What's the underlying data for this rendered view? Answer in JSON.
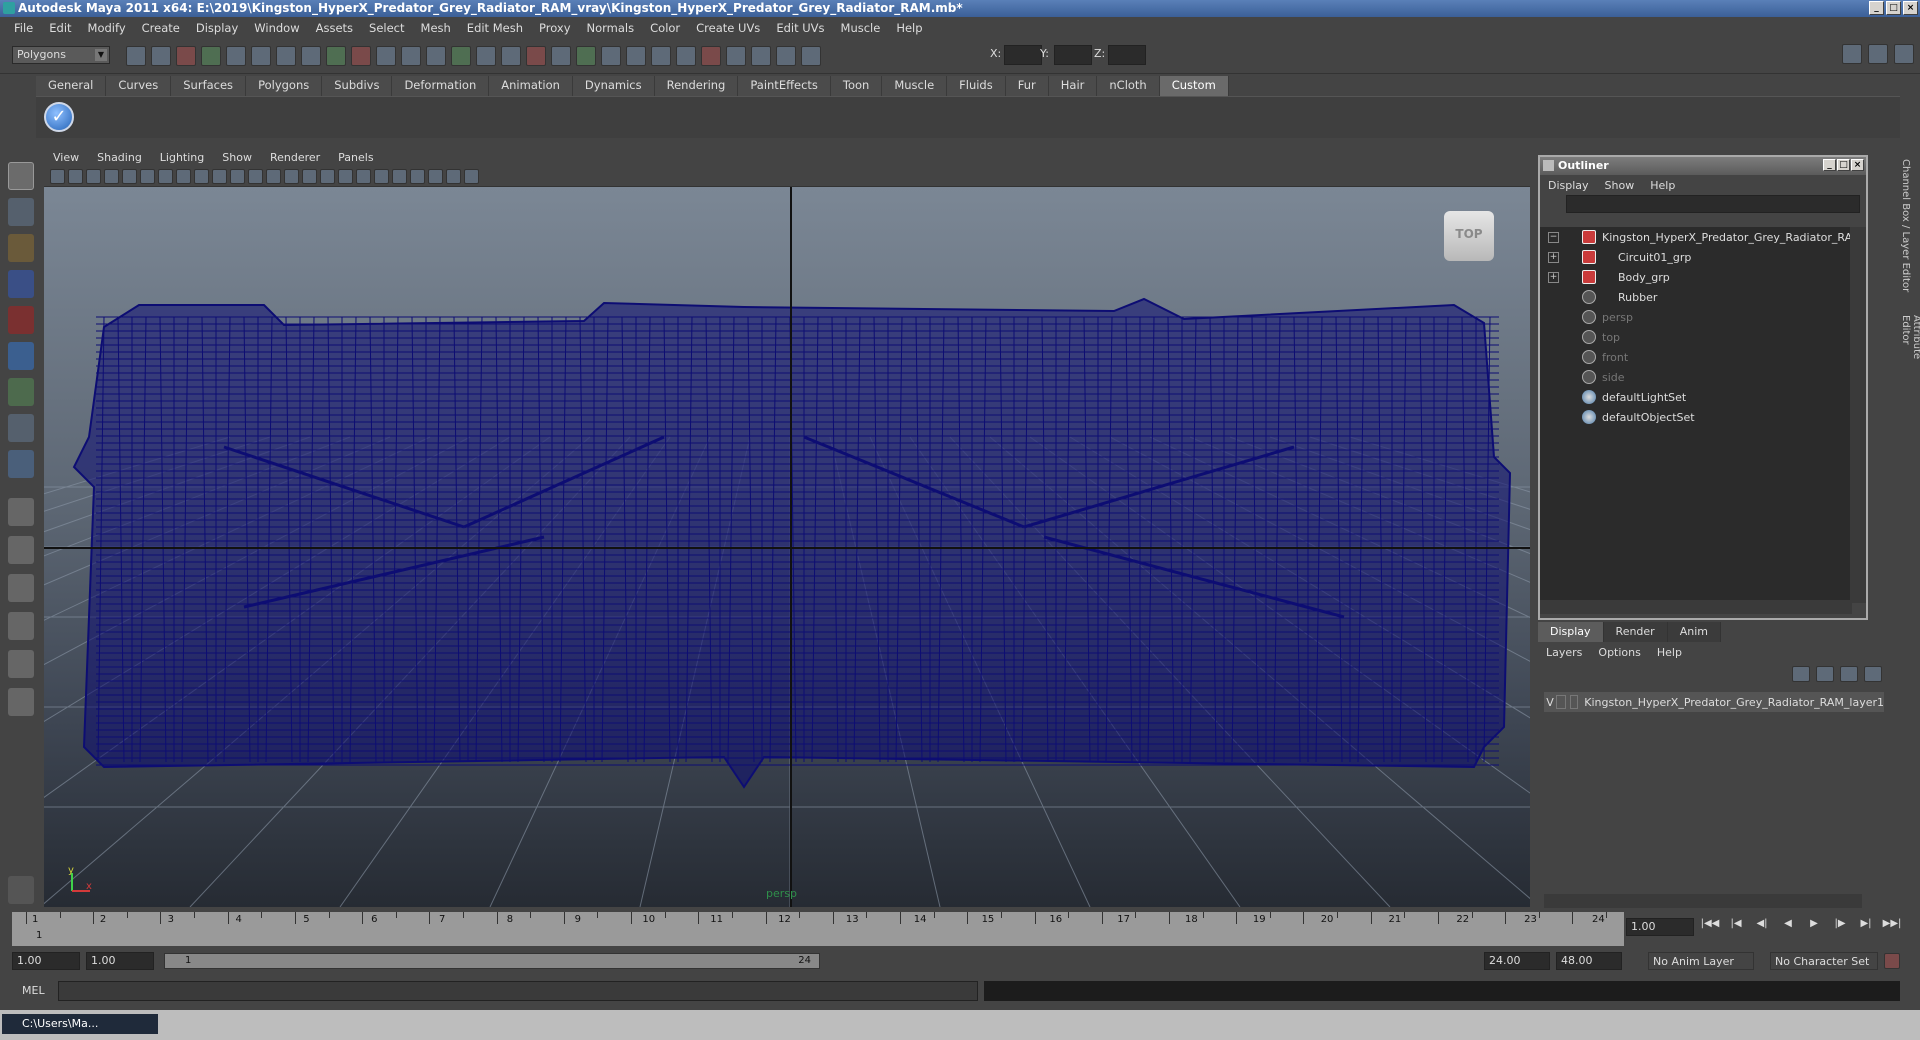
{
  "window": {
    "title": "Autodesk Maya 2011 x64: E:\\2019\\Kingston_HyperX_Predator_Grey_Radiator_RAM_vray\\Kingston_HyperX_Predator_Grey_Radiator_RAM.mb*",
    "min": "_",
    "max": "□",
    "close": "×"
  },
  "menu": [
    "File",
    "Edit",
    "Modify",
    "Create",
    "Display",
    "Window",
    "Assets",
    "Select",
    "Mesh",
    "Edit Mesh",
    "Proxy",
    "Normals",
    "Color",
    "Create UVs",
    "Edit UVs",
    "Muscle",
    "Help"
  ],
  "toolbar": {
    "mode": "Polygons",
    "x_label": "X:",
    "y_label": "Y:",
    "z_label": "Z:"
  },
  "shelf_tabs": [
    "General",
    "Curves",
    "Surfaces",
    "Polygons",
    "Subdivs",
    "Deformation",
    "Animation",
    "Dynamics",
    "Rendering",
    "PaintEffects",
    "Toon",
    "Muscle",
    "Fluids",
    "Fur",
    "Hair",
    "nCloth",
    "Custom"
  ],
  "shelf_active": "Custom",
  "viewport": {
    "menu": [
      "View",
      "Shading",
      "Lighting",
      "Show",
      "Renderer",
      "Panels"
    ],
    "cube_label": "TOP",
    "camera_label": "persp",
    "mesh_color": "#0d0d73"
  },
  "outliner": {
    "title": "Outliner",
    "menu": [
      "Display",
      "Show",
      "Help"
    ],
    "items": [
      {
        "label": "Kingston_HyperX_Predator_Grey_Radiator_RAM",
        "kind": "grp",
        "expand": "−",
        "dim": false,
        "indent": 0
      },
      {
        "label": "Circuit01_grp",
        "kind": "grp",
        "expand": "+",
        "dim": false,
        "indent": 1
      },
      {
        "label": "Body_grp",
        "kind": "grp",
        "expand": "+",
        "dim": false,
        "indent": 1
      },
      {
        "label": "Rubber",
        "kind": "mesh",
        "expand": "",
        "dim": false,
        "indent": 1
      },
      {
        "label": "persp",
        "kind": "cam",
        "expand": "",
        "dim": true,
        "indent": 0
      },
      {
        "label": "top",
        "kind": "cam",
        "expand": "",
        "dim": true,
        "indent": 0
      },
      {
        "label": "front",
        "kind": "cam",
        "expand": "",
        "dim": true,
        "indent": 0
      },
      {
        "label": "side",
        "kind": "cam",
        "expand": "",
        "dim": true,
        "indent": 0
      },
      {
        "label": "defaultLightSet",
        "kind": "set",
        "expand": "",
        "dim": false,
        "indent": 0
      },
      {
        "label": "defaultObjectSet",
        "kind": "set",
        "expand": "",
        "dim": false,
        "indent": 0
      }
    ]
  },
  "layers": {
    "tabs": [
      "Display",
      "Render",
      "Anim"
    ],
    "menu": [
      "Layers",
      "Options",
      "Help"
    ],
    "row": {
      "visible": "V",
      "name": "Kingston_HyperX_Predator_Grey_Radiator_RAM_layer1"
    }
  },
  "side_tabs": [
    "Channel Box / Layer Editor",
    "Attribute Editor"
  ],
  "timeline": {
    "ticks": [
      "1",
      "2",
      "3",
      "4",
      "5",
      "6",
      "7",
      "8",
      "9",
      "10",
      "11",
      "12",
      "13",
      "14",
      "15",
      "16",
      "17",
      "18",
      "19",
      "20",
      "21",
      "22",
      "23",
      "24"
    ],
    "current": "1",
    "current_frame_field": "1.00",
    "play_buttons": [
      "|◀◀",
      "|◀",
      "◀|",
      "◀",
      "▶",
      "|▶",
      "▶|",
      "▶▶|"
    ]
  },
  "range": {
    "start": "1.00",
    "playback_start": "1.00",
    "slider_min": "1",
    "slider_max": "24",
    "playback_end": "24.00",
    "end": "48.00",
    "anim_layer": "No Anim Layer",
    "char_set": "No Character Set"
  },
  "mel": {
    "label": "MEL"
  },
  "taskbar": {
    "button": "C:\\Users\\Ma..."
  }
}
